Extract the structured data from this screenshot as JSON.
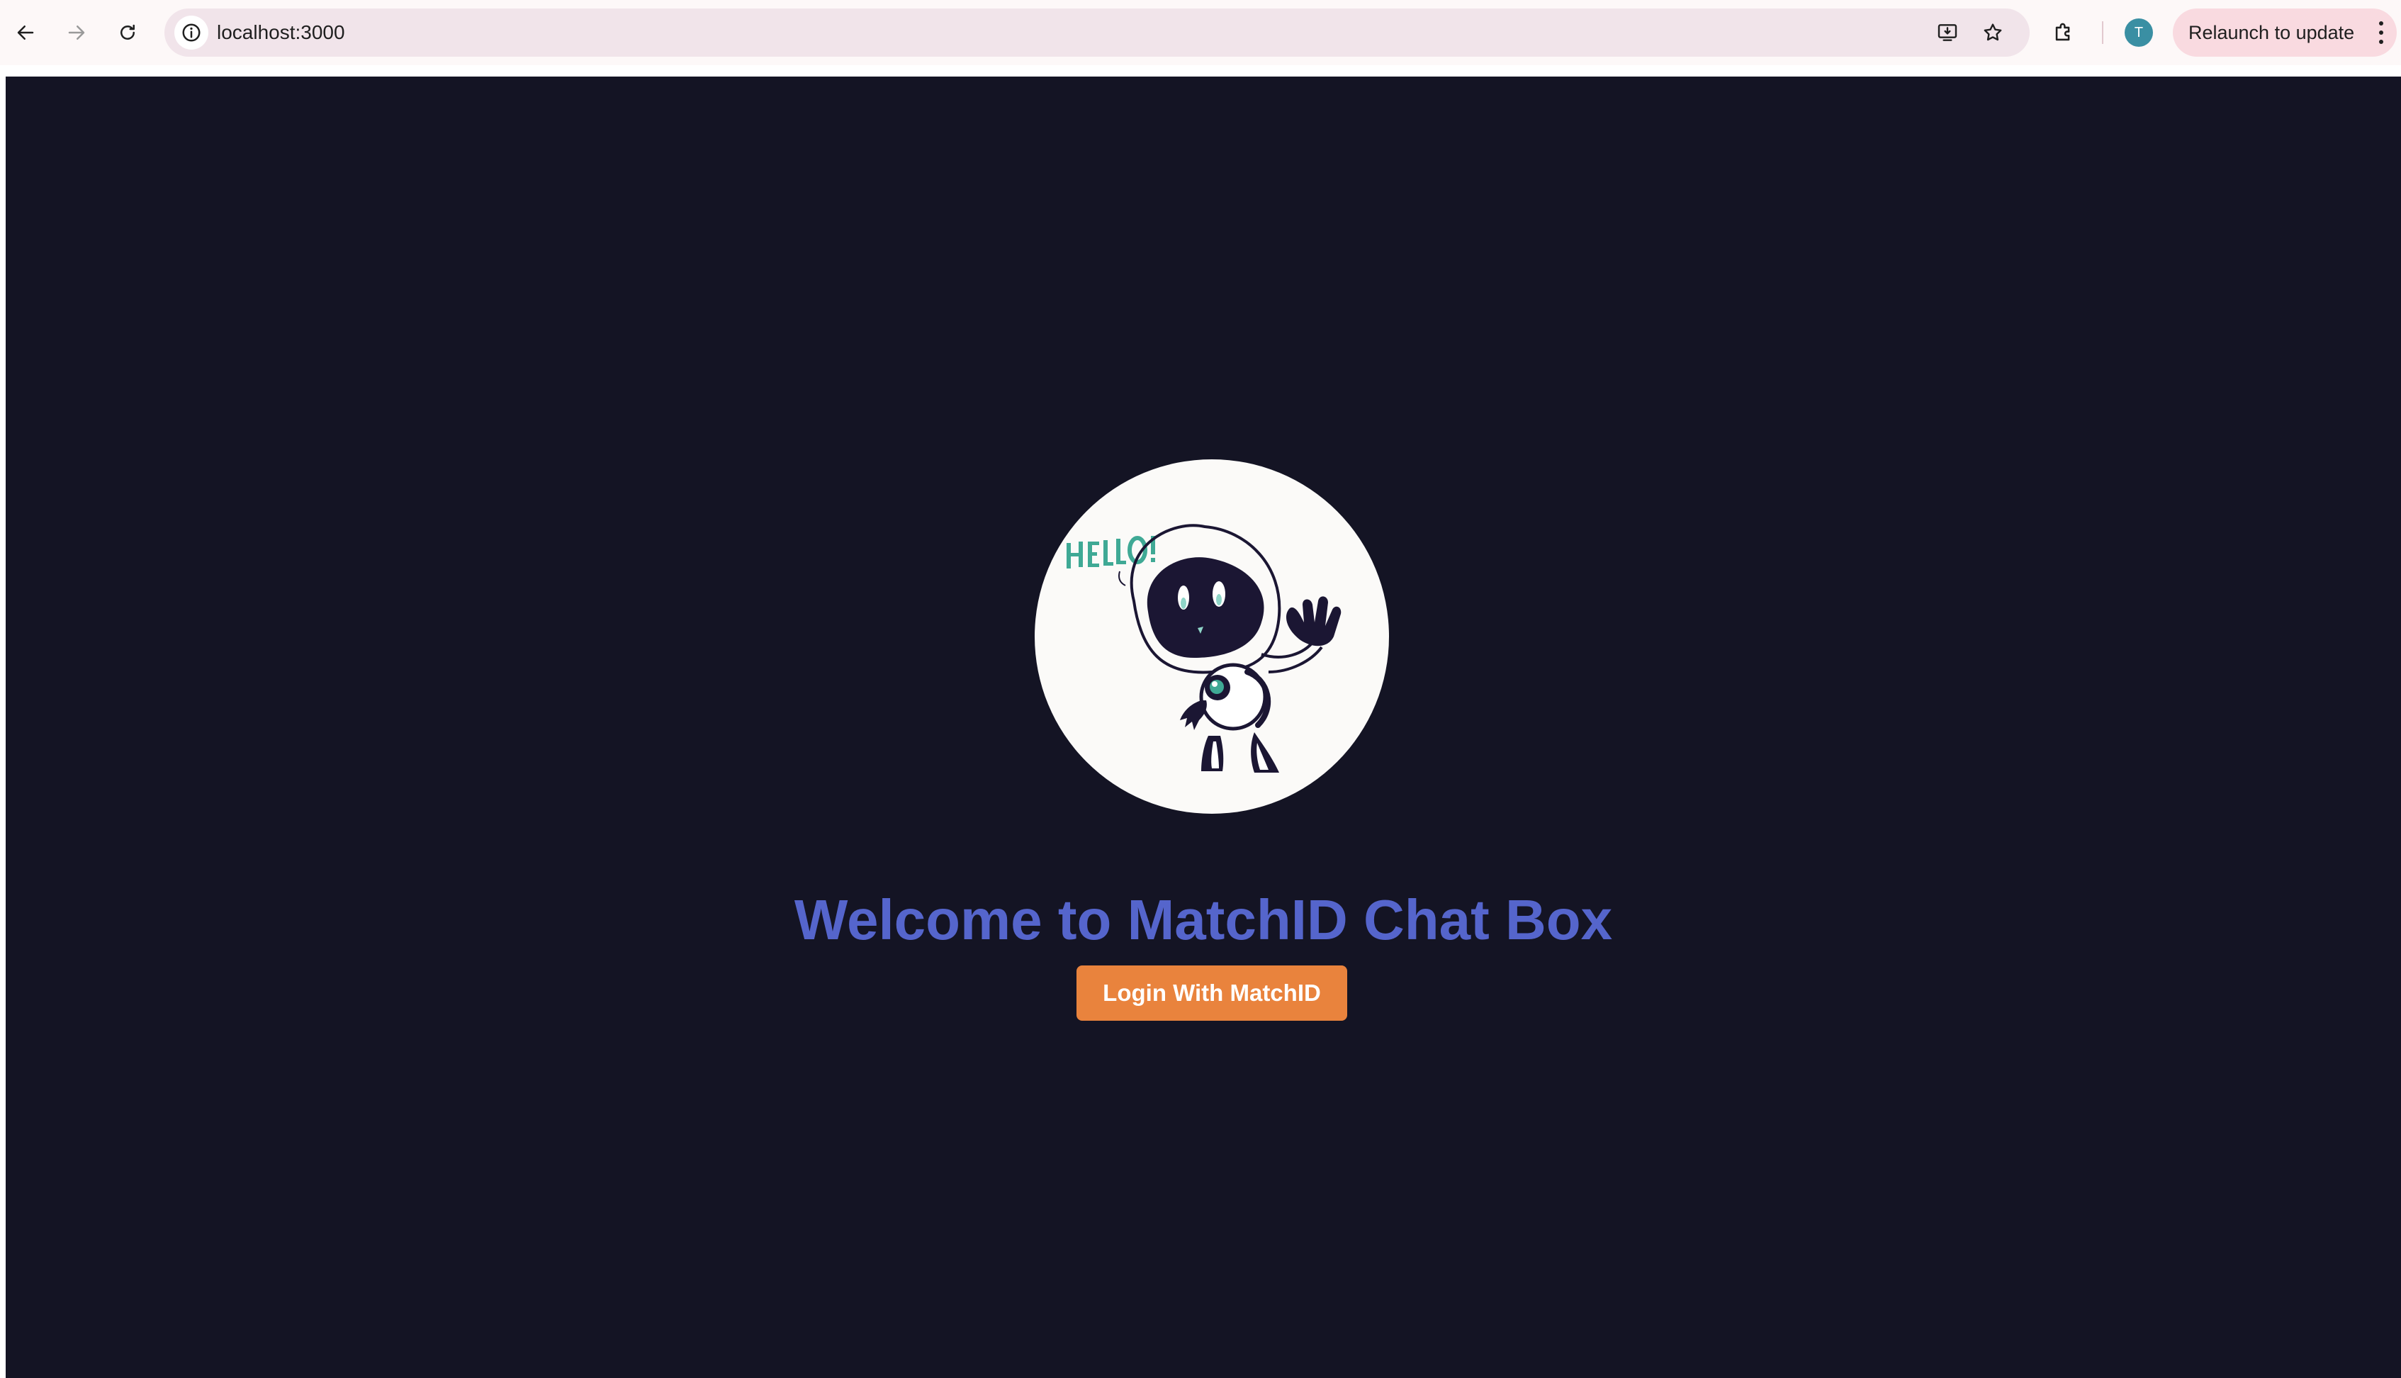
{
  "browser": {
    "url": "localhost:3000",
    "profile_initial": "T",
    "relaunch_label": "Relaunch to update",
    "icons": {
      "back": "arrow-left-icon",
      "forward": "arrow-right-icon",
      "reload": "reload-icon",
      "site_info": "info-icon",
      "install": "install-app-icon",
      "bookmark": "star-icon",
      "extensions": "puzzle-icon",
      "menu": "kebab-menu-icon"
    },
    "colors": {
      "omnibox": "#f1e4ea",
      "relaunch": "#f9dae0",
      "avatar": "#3a8fa3"
    }
  },
  "page": {
    "background": "#141424",
    "hero_image": {
      "name": "robot-hello-illustration",
      "lettering": "HELLO!"
    },
    "welcome_title": "Welcome to MatchID Chat Box",
    "login_button_label": "Login With MatchID",
    "colors": {
      "title": "#5565cc",
      "button": "#e9833d"
    }
  }
}
